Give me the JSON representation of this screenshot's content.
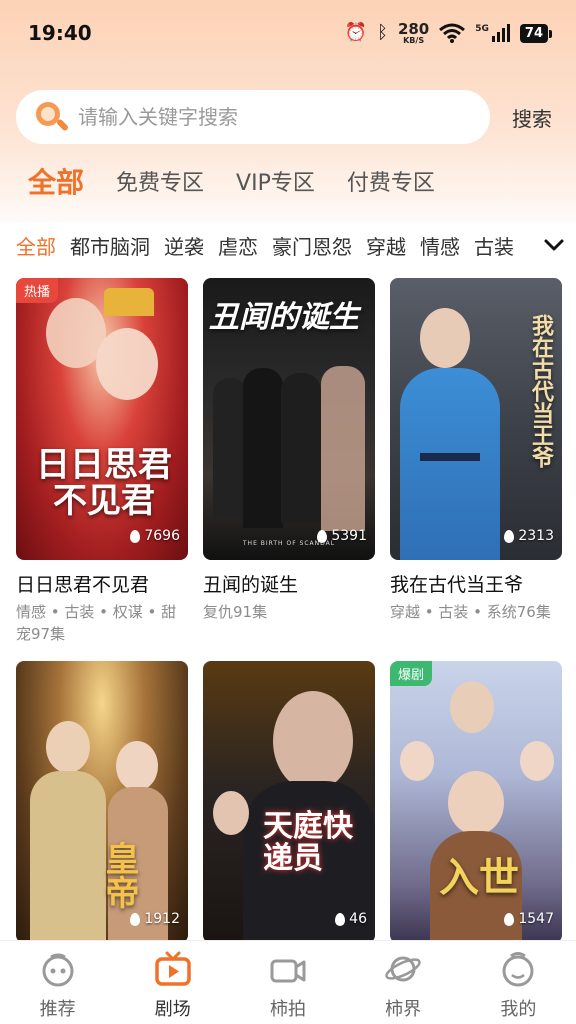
{
  "status_bar": {
    "time": "19:40",
    "net_speed": "280",
    "net_unit": "KB/S",
    "network": "5G",
    "battery": "74"
  },
  "search": {
    "placeholder": "请输入关键字搜索",
    "button_label": "搜索"
  },
  "zone_tabs": [
    "全部",
    "免费专区",
    "VIP专区",
    "付费专区"
  ],
  "genres": [
    "全部",
    "都市脑洞",
    "逆袭",
    "虐恋",
    "豪门恩怨",
    "穿越",
    "情感",
    "古装"
  ],
  "dramas": [
    {
      "title": "日日思君不见君",
      "tags": "情感 • 古装 • 权谋 • 甜宠97集",
      "views": "7696",
      "badge": "热播",
      "poster_text": "日日思君不见君"
    },
    {
      "title": "丑闻的诞生",
      "tags": "复仇91集",
      "views": "5391",
      "badge": "",
      "poster_text": "丑闻的诞生",
      "poster_subtext": "THE BIRTH OF SCANDAL"
    },
    {
      "title": "我在古代当王爷",
      "tags": "穿越 • 古装 • 系统76集",
      "views": "2313",
      "badge": "",
      "poster_text": "我在古代当王爷"
    },
    {
      "title": "",
      "tags": "",
      "views": "1912",
      "badge": "",
      "poster_text": "皇帝"
    },
    {
      "title": "",
      "tags": "",
      "views": "46",
      "badge": "",
      "poster_text": "天庭快递员"
    },
    {
      "title": "",
      "tags": "",
      "views": "1547",
      "badge": "爆剧",
      "poster_text": "入世"
    }
  ],
  "bottom_nav": [
    "推荐",
    "剧场",
    "柿拍",
    "柿界",
    "我的"
  ],
  "colors": {
    "accent": "#f0712a",
    "badge_hot": "#e8473c",
    "badge_explosive": "#3cb871"
  }
}
